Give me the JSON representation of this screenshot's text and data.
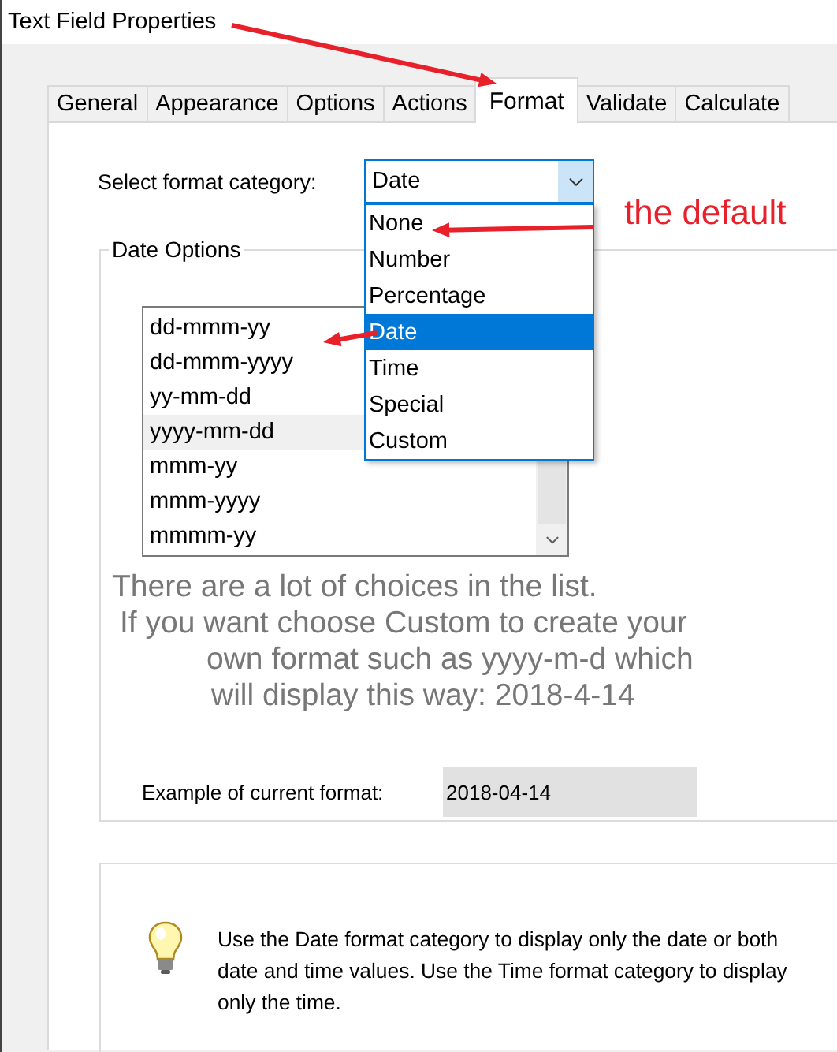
{
  "window": {
    "title": "Text Field Properties"
  },
  "tabs": [
    {
      "label": "General",
      "selected": false
    },
    {
      "label": "Appearance",
      "selected": false
    },
    {
      "label": "Options",
      "selected": false
    },
    {
      "label": "Actions",
      "selected": false
    },
    {
      "label": "Format",
      "selected": true
    },
    {
      "label": "Validate",
      "selected": false
    },
    {
      "label": "Calculate",
      "selected": false
    }
  ],
  "format": {
    "label": "Select format category:",
    "value": "Date",
    "expanded": true,
    "options": [
      {
        "label": "None",
        "selected": false
      },
      {
        "label": "Number",
        "selected": false
      },
      {
        "label": "Percentage",
        "selected": false
      },
      {
        "label": "Date",
        "selected": true
      },
      {
        "label": "Time",
        "selected": false
      },
      {
        "label": "Special",
        "selected": false
      },
      {
        "label": "Custom",
        "selected": false
      }
    ]
  },
  "date_options": {
    "title": "Date Options",
    "formats": [
      {
        "label": "dd-mmm-yy",
        "selected": false
      },
      {
        "label": "dd-mmm-yyyy",
        "selected": false
      },
      {
        "label": "yy-mm-dd",
        "selected": false
      },
      {
        "label": "yyyy-mm-dd",
        "selected": true
      },
      {
        "label": "mmm-yy",
        "selected": false
      },
      {
        "label": "mmm-yyyy",
        "selected": false
      },
      {
        "label": "mmmm-yy",
        "selected": false
      }
    ]
  },
  "example": {
    "label": "Example of current format:",
    "value": "2018-04-14"
  },
  "tip": {
    "text": "Use the Date format category to display only the date or both date and time values. Use the Time format category to display only the time."
  },
  "annotations": {
    "callout": "the default",
    "note_lines": [
      "There are a lot of choices in the list.",
      "If you want choose Custom to create your",
      "own format such as yyyy-m-d which",
      "will display this way: 2018-4-14"
    ]
  }
}
